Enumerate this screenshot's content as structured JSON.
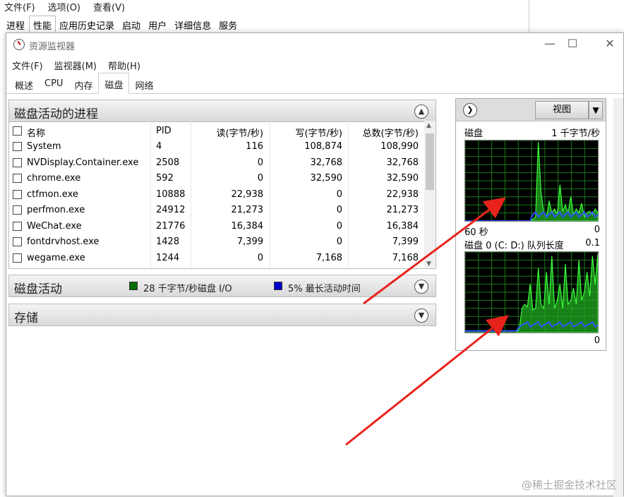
{
  "task_manager": {
    "menu": [
      "文件(F)",
      "选项(O)",
      "查看(V)"
    ],
    "tabs": [
      "进程",
      "性能",
      "应用历史记录",
      "启动",
      "用户",
      "详细信息",
      "服务"
    ],
    "active_tab": "性能"
  },
  "window": {
    "title": "资源监视器",
    "menu": [
      "文件(F)",
      "监视器(M)",
      "帮助(H)"
    ],
    "tabs": [
      "概述",
      "CPU",
      "内存",
      "磁盘",
      "网络"
    ],
    "active_tab": "磁盘"
  },
  "processes_panel": {
    "title": "磁盘活动的进程",
    "columns": [
      "名称",
      "PID",
      "读(字节/秒)",
      "写(字节/秒)",
      "总数(字节/秒)"
    ],
    "rows": [
      {
        "name": "System",
        "pid": "4",
        "read": "116",
        "write": "108,874",
        "total": "108,990"
      },
      {
        "name": "NVDisplay.Container.exe",
        "pid": "2508",
        "read": "0",
        "write": "32,768",
        "total": "32,768"
      },
      {
        "name": "chrome.exe",
        "pid": "592",
        "read": "0",
        "write": "32,590",
        "total": "32,590"
      },
      {
        "name": "ctfmon.exe",
        "pid": "10888",
        "read": "22,938",
        "write": "0",
        "total": "22,938"
      },
      {
        "name": "perfmon.exe",
        "pid": "24912",
        "read": "21,273",
        "write": "0",
        "total": "21,273"
      },
      {
        "name": "WeChat.exe",
        "pid": "21776",
        "read": "16,384",
        "write": "0",
        "total": "16,384"
      },
      {
        "name": "fontdrvhost.exe",
        "pid": "1428",
        "read": "7,399",
        "write": "0",
        "total": "7,399"
      },
      {
        "name": "wegame.exe",
        "pid": "1244",
        "read": "0",
        "write": "7,168",
        "total": "7,168"
      }
    ]
  },
  "disk_activity_panel": {
    "title": "磁盘活动",
    "io_legend": "28 千字节/秒磁盘 I/O",
    "io_color": "#0a6b0a",
    "active_legend": "5% 最长活动时间",
    "active_color": "#0000cc"
  },
  "storage_panel": {
    "title": "存储"
  },
  "right_pane": {
    "view_button": "视图",
    "graph1": {
      "title": "磁盘",
      "scale": "1 千字节/秒",
      "time_label": "60 秒",
      "min": "0"
    },
    "graph2": {
      "title": "磁盘 0 (C: D:) 队列长度",
      "scale": "0.1",
      "min": "0"
    },
    "graph_colors": {
      "grid": "#1a7a1a",
      "fill": "#22aa22",
      "line": "#3cff3c",
      "secondary": "#3050ff"
    }
  },
  "watermark": "@稀土掘金技术社区"
}
